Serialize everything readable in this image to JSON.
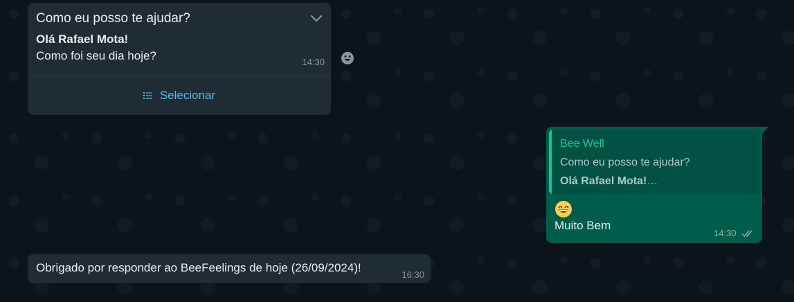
{
  "list_message": {
    "header": "Como eu posso te ajudar?",
    "greeting": "Olá Rafael Mota!",
    "body": "Como foi seu dia hoje?",
    "time": "14:30",
    "select_label": "Selecionar",
    "icons": [
      "chevron-down-icon",
      "list-icon"
    ]
  },
  "reaction_button": {
    "icon": "smiley-icon"
  },
  "reply_message": {
    "quote": {
      "author": "Bee Well",
      "line1": "Como eu posso te ajudar?",
      "line2": "Olá Rafael Mota!",
      "ellipsis": "…"
    },
    "emoji": "grinning-face-emoji",
    "text": "Muito Bem",
    "time": "14:30",
    "status_icon": "double-check-icon"
  },
  "thanks_message": {
    "text": "Obrigado por responder ao BeeFeelings de hoje (26/09/2024)!",
    "time": "16:30"
  },
  "colors": {
    "background": "#0b141a",
    "incoming_bubble": "#202c33",
    "outgoing_bubble": "#005c4b",
    "quote_accent": "#06cf9c",
    "link": "#53bdeb",
    "timestamp": "#8696a0"
  }
}
